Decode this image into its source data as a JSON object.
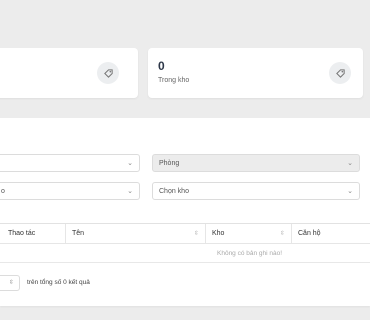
{
  "stats": {
    "card2": {
      "value": "0",
      "label": "Trong kho",
      "icon": "tag-icon"
    },
    "card1": {
      "icon": "tag-icon"
    }
  },
  "filters": {
    "left_top": {
      "value": ""
    },
    "left_bottom": {
      "value": "o"
    },
    "right_top": {
      "value": "Phòng"
    },
    "right_bottom": {
      "value": "Chọn kho"
    }
  },
  "table": {
    "columns": [
      "Thao tác",
      "Tên",
      "Kho",
      "Căn hộ"
    ],
    "empty_text": "Không có bản ghi nào!"
  },
  "footer": {
    "summary": "trên tổng số 0 kết quả"
  },
  "colors": {
    "page_bg": "#ececec",
    "card_bg": "#ffffff",
    "select_gray": "#ececec"
  }
}
